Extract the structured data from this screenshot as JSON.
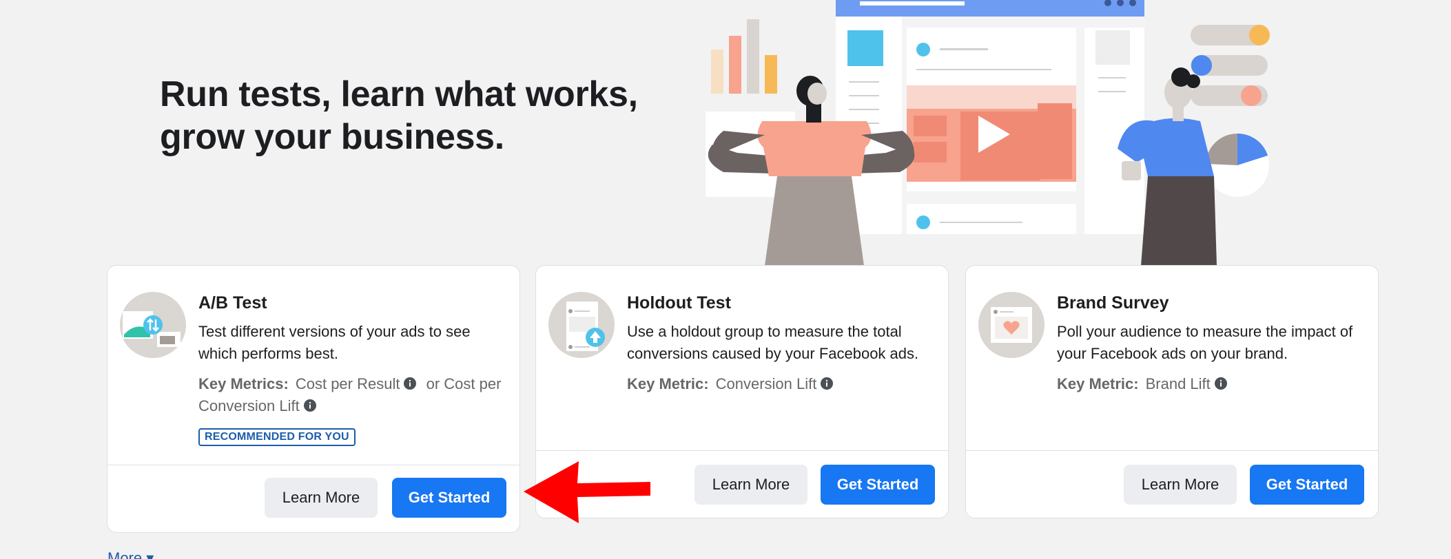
{
  "hero": {
    "headline_line1": "Run tests, learn what works,",
    "headline_line2": "grow your business."
  },
  "cards": [
    {
      "title": "A/B Test",
      "description": "Test different versions of your ads to see which performs best.",
      "metrics_label": "Key Metrics:",
      "metric_1": "Cost per Result",
      "metric_join": "or Cost per",
      "metric_2": "Conversion Lift",
      "badge": "RECOMMENDED FOR YOU",
      "learn_more": "Learn More",
      "get_started": "Get Started"
    },
    {
      "title": "Holdout Test",
      "description": "Use a holdout group to measure the total conversions caused by your Facebook ads.",
      "metrics_label": "Key Metric:",
      "metric_1": "Conversion Lift",
      "learn_more": "Learn More",
      "get_started": "Get Started"
    },
    {
      "title": "Brand Survey",
      "description": "Poll your audience to measure the impact of your Facebook ads on your brand.",
      "metrics_label": "Key Metric:",
      "metric_1": "Brand Lift",
      "learn_more": "Learn More",
      "get_started": "Get Started"
    }
  ],
  "footer": {
    "more_link": "More ▾"
  },
  "colors": {
    "primary": "#1877f2",
    "page_bg": "#f2f2f2",
    "link": "#1a5dab",
    "annotation_arrow": "#ff0000"
  },
  "icons": [
    "ab-test-icon",
    "holdout-test-icon",
    "brand-survey-icon",
    "info-icon",
    "annotation-arrow"
  ]
}
